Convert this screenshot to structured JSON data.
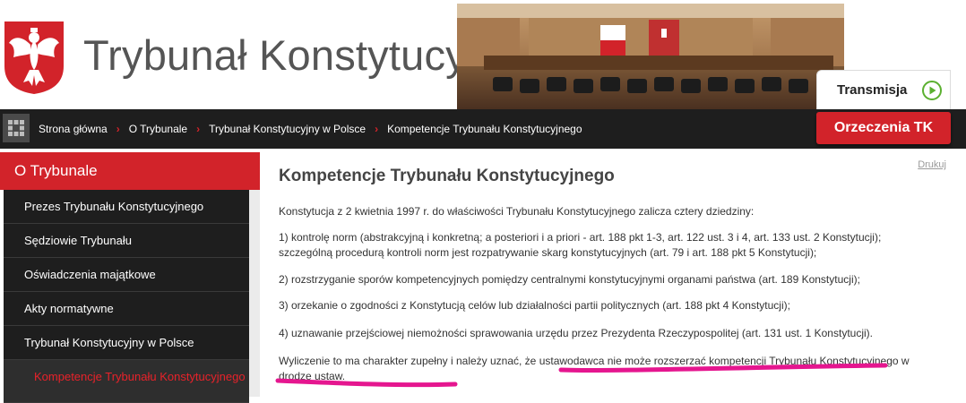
{
  "header": {
    "site_title": "Trybunał Konstytucyjny",
    "transmisja_label": "Transmisja",
    "emblem_icon": "polish-eagle-emblem",
    "play_icon": "play-circle-icon"
  },
  "breadcrumb": {
    "items": [
      {
        "label": "Strona główna"
      },
      {
        "label": "O Trybunale"
      },
      {
        "label": "Trybunał Konstytucyjny w Polsce"
      },
      {
        "label": "Kompetencje Trybunału Konstytucyjnego"
      }
    ],
    "separator": "›"
  },
  "orzeczenia_label": "Orzeczenia TK",
  "sidebar": {
    "header": "O Trybunale",
    "items": [
      {
        "label": "Prezes Trybunału Konstytucyjnego"
      },
      {
        "label": "Sędziowie Trybunału"
      },
      {
        "label": "Oświadczenia majątkowe"
      },
      {
        "label": "Akty normatywne"
      },
      {
        "label": "Trybunał Konstytucyjny w Polsce"
      },
      {
        "label": "Kompetencje Trybunału Konstytucyjnego"
      }
    ]
  },
  "main": {
    "print_label": "Drukuj",
    "title": "Kompetencje Trybunału Konstytucyjnego",
    "intro": "Konstytucja z 2 kwietnia 1997 r. do właściwości Trybunału Konstytucyjnego zalicza cztery dziedziny:",
    "paragraphs": [
      "1) kontrolę norm (abstrakcyjną i konkretną; a posteriori i a priori - art. 188 pkt 1-3, art. 122 ust. 3 i 4, art. 133 ust. 2 Konstytucji); szczególną procedurą kontroli norm jest rozpatrywanie skarg konstytucyjnych (art. 79 i art. 188 pkt 5 Konstytucji);",
      "2) rozstrzyganie sporów kompetencyjnych pomiędzy centralnymi konstytucyjnymi organami państwa (art. 189 Konstytucji);",
      "3) orzekanie o zgodności z Konstytucją celów lub działalności partii politycznych (art. 188 pkt 4 Konstytucji);",
      "4) uznawanie przejściowej niemożności sprawowania urzędu przez Prezydenta Rzeczypospolitej (art. 131 ust. 1 Konstytucji)."
    ],
    "closing": "Wyliczenie to ma charakter zupełny i należy uznać, że ustawodawca nie może rozszerzać kompetencji Trybunału Konstytucyjnego w drodze ustaw."
  },
  "colors": {
    "brand_red": "#d2232a",
    "nav_dark": "#1e1e1e",
    "highlight_marker": "#e5168f"
  }
}
